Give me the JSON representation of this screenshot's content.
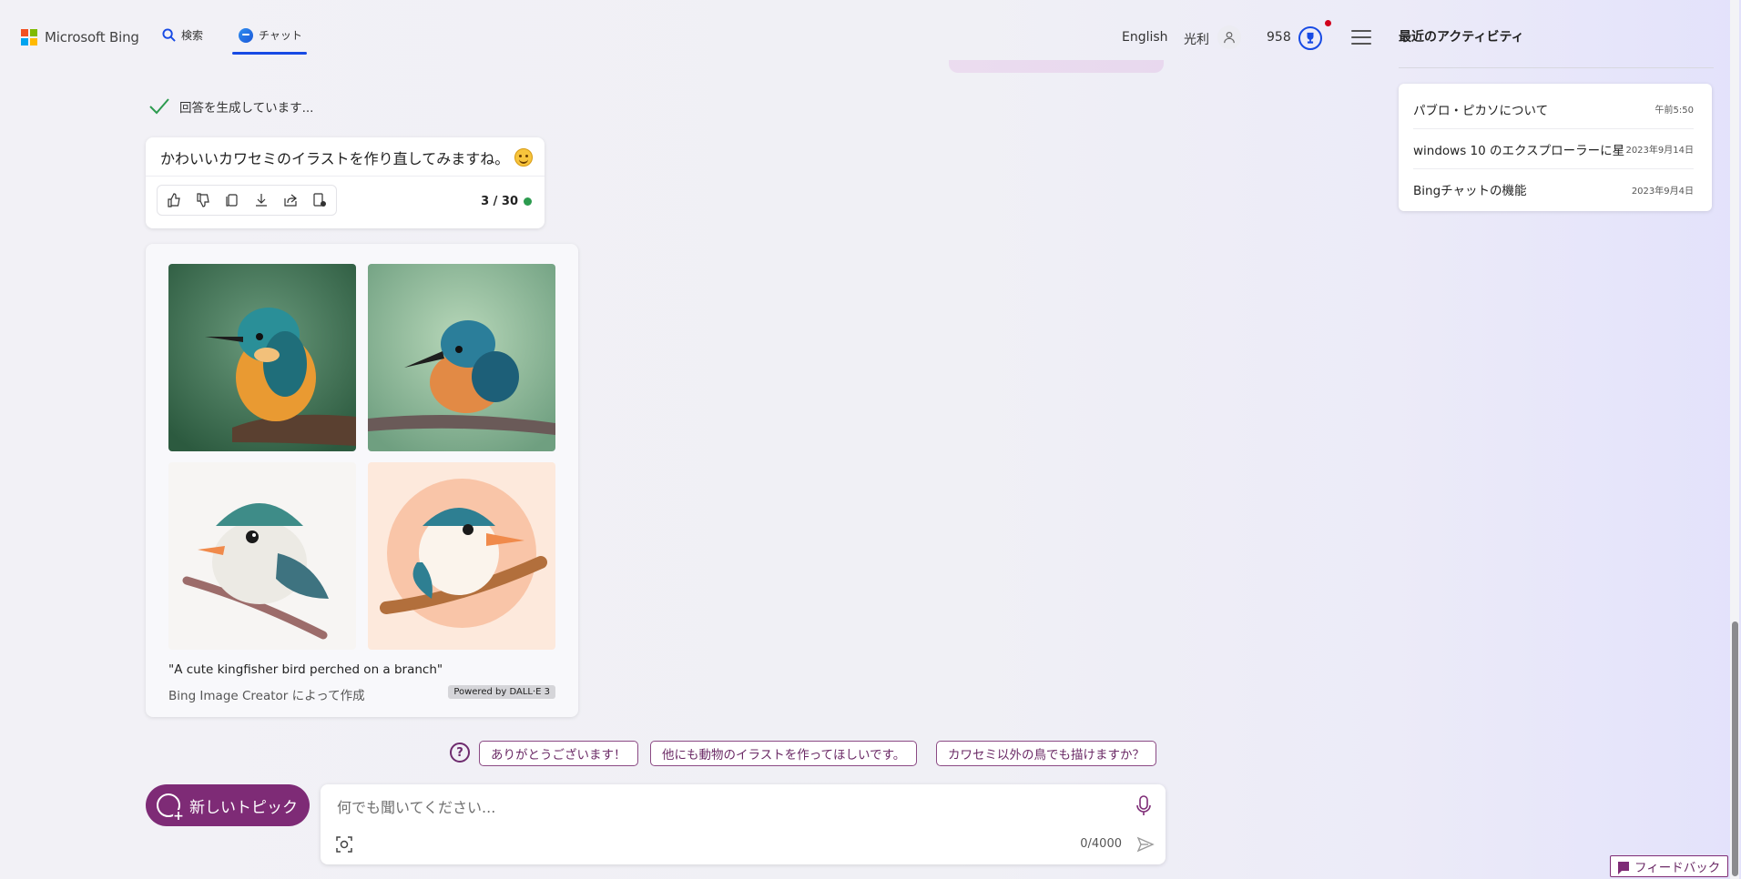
{
  "header": {
    "logo_text": "Microsoft Bing",
    "tabs": [
      {
        "label": "検索",
        "icon": "search-icon"
      },
      {
        "label": "チャット",
        "icon": "chat-icon",
        "active": true
      }
    ],
    "language": "English",
    "user_name": "光利",
    "points": "958",
    "accent_color": "#174ae4"
  },
  "activity": {
    "title": "最近のアクティビティ",
    "items": [
      {
        "label": "パブロ・ピカソについて",
        "time": "午前5:50"
      },
      {
        "label": "windows 10 のエクスプローラーに星",
        "time": "2023年9月14日"
      },
      {
        "label": "Bingチャットの機能",
        "time": "2023年9月4日"
      }
    ]
  },
  "chat": {
    "status": "回答を生成しています...",
    "reply": "かわいいカワセミのイラストを作り直してみますね。",
    "counter": "3 / 30",
    "actions": [
      "like-icon",
      "dislike-icon",
      "copy-icon",
      "download-icon",
      "share-icon",
      "export-icon"
    ]
  },
  "images": {
    "caption": "\"A cute kingfisher bird perched on a branch\"",
    "creator": "Bing Image Creator によって作成",
    "badge": "Powered by DALL·E 3"
  },
  "suggestions": {
    "items": [
      "ありがとうございます！",
      "他にも動物のイラストを作ってほしいです。",
      "カワセミ以外の鳥でも描けますか？"
    ]
  },
  "composer": {
    "new_topic_label": "新しいトピック",
    "placeholder": "何でも聞いてください...",
    "char_count": "0/4000",
    "brand_color": "#7e2b76"
  },
  "feedback": {
    "label": "フィードバック"
  }
}
